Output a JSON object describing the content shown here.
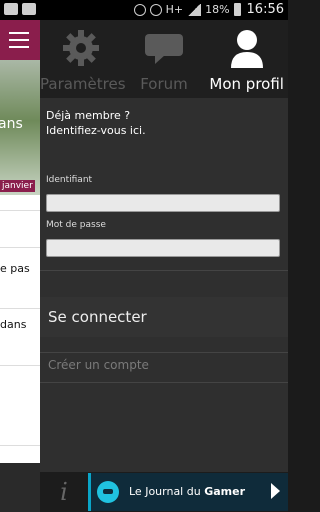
{
  "status_bar": {
    "battery": "18%",
    "time": "16:56",
    "network": "H+"
  },
  "background_list": {
    "headline_fragment": "ans",
    "date": "janvier",
    "row1_fragment": "e pas",
    "row2_fragment": "dans"
  },
  "tabs": [
    {
      "label": "Paramètres"
    },
    {
      "label": "Forum"
    },
    {
      "label": "Mon profil"
    }
  ],
  "login": {
    "intro_line1": "Déjà membre ?",
    "intro_line2": "Identifiez-vous ici.",
    "username_label": "Identifiant",
    "username_value": "",
    "password_label": "Mot de passe",
    "password_value": "",
    "connect_label": "Se connecter",
    "create_label": "Créer un compte"
  },
  "banner": {
    "prefix": "Le Journal du ",
    "brand": "Gamer",
    "accent": "#0aa5c8"
  }
}
